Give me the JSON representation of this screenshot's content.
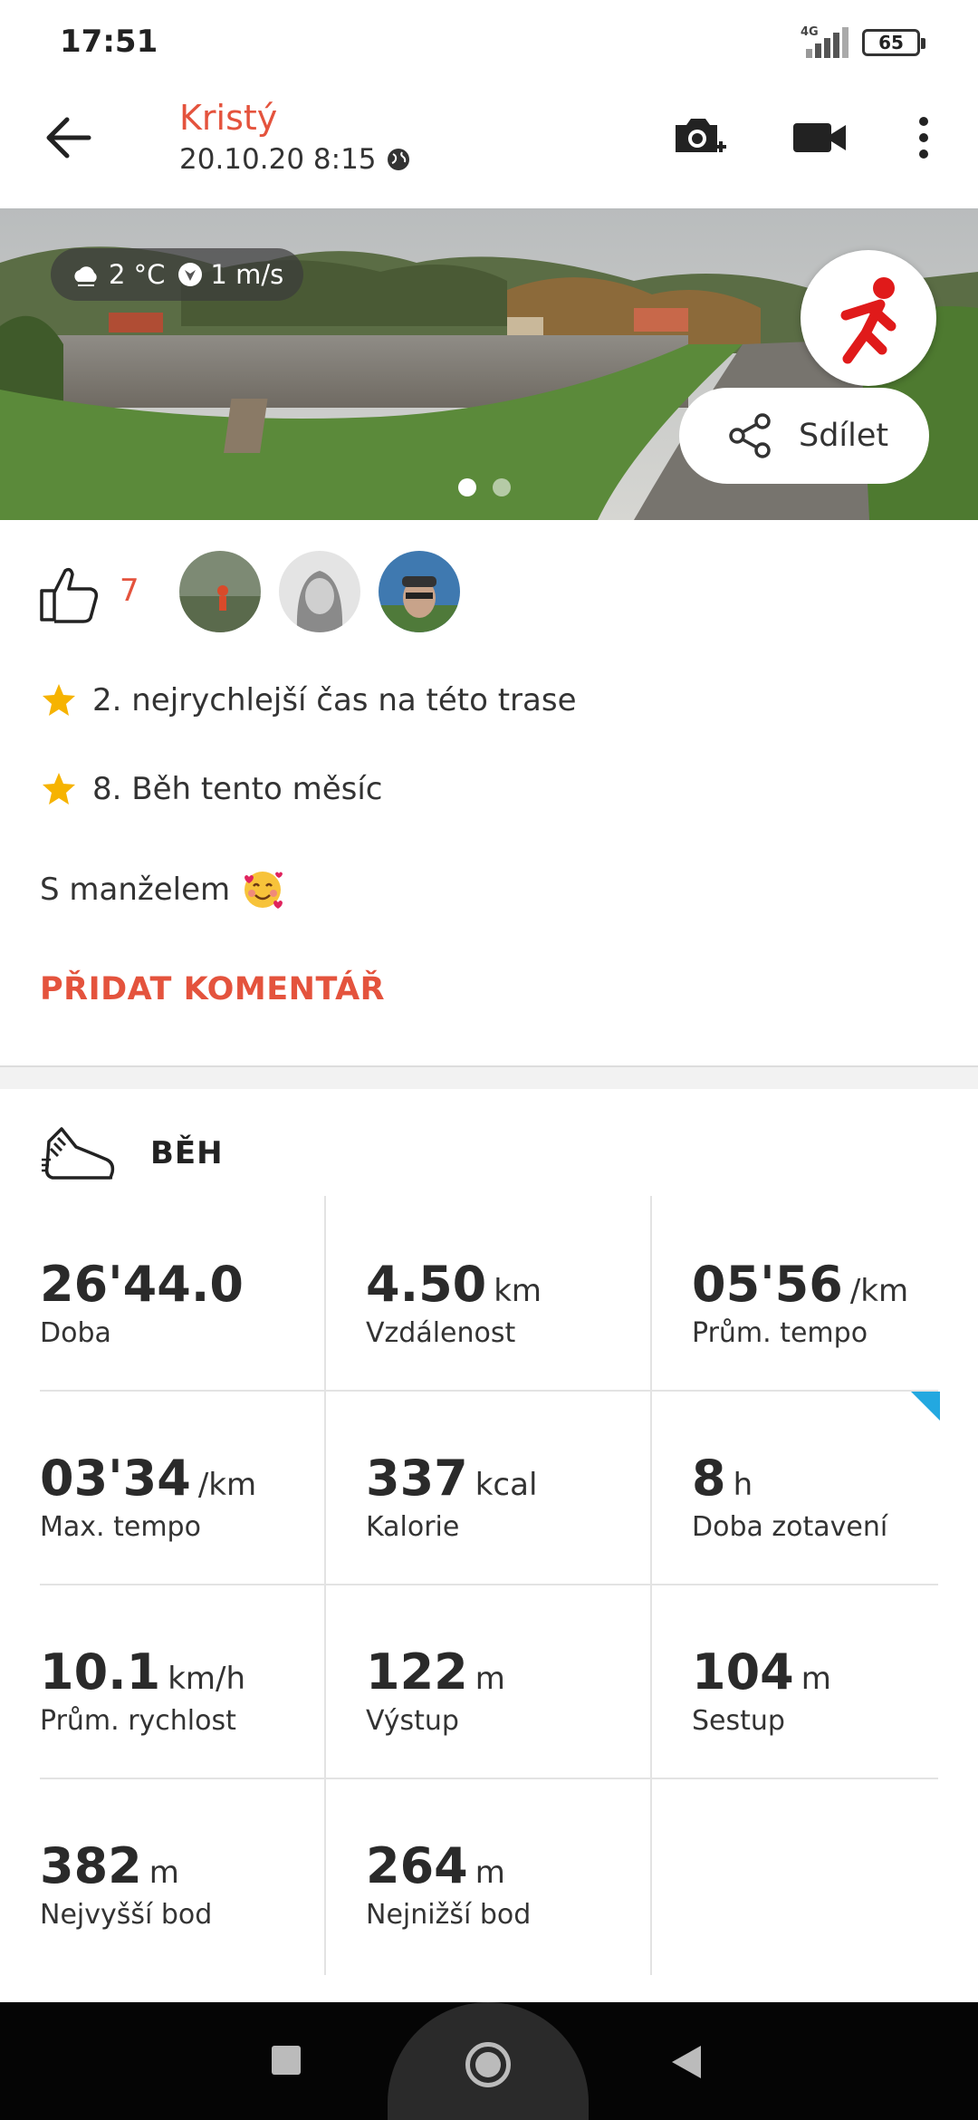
{
  "status_bar": {
    "time": "17:51",
    "network": "4G",
    "battery": "65"
  },
  "header": {
    "user_name": "Kristý",
    "datetime": "20.10.20 8:15"
  },
  "photo": {
    "weather_temp": "2 °C",
    "wind": "1 m/s",
    "share_label": "Sdílet",
    "page_count": 2,
    "active_page": 1
  },
  "likes": {
    "count": "7"
  },
  "achievements": [
    {
      "text": "2. nejrychlejší čas na této trase"
    },
    {
      "text": "8. Běh tento měsíc"
    }
  ],
  "caption": {
    "text": "S manželem"
  },
  "add_comment_label": "PŘIDAT KOMENTÁŘ",
  "activity": {
    "type_label": "BĚH"
  },
  "stats": [
    {
      "value": "26'44.0",
      "unit": "",
      "label": "Doba"
    },
    {
      "value": "4.50",
      "unit": "km",
      "label": "Vzdálenost"
    },
    {
      "value": "05'56",
      "unit": "/km",
      "label": "Prům. tempo"
    },
    {
      "value": "03'34",
      "unit": "/km",
      "label": "Max. tempo"
    },
    {
      "value": "337",
      "unit": "kcal",
      "label": "Kalorie"
    },
    {
      "value": "8",
      "unit": "h",
      "label": "Doba zotavení"
    },
    {
      "value": "10.1",
      "unit": "km/h",
      "label": "Prům. rychlost"
    },
    {
      "value": "122",
      "unit": "m",
      "label": "Výstup"
    },
    {
      "value": "104",
      "unit": "m",
      "label": "Sestup"
    },
    {
      "value": "382",
      "unit": "m",
      "label": "Nejvyšší bod"
    },
    {
      "value": "264",
      "unit": "m",
      "label": "Nejnižší bod"
    }
  ],
  "colors": {
    "accent": "#e4533d",
    "flag": "#23a8e0"
  }
}
